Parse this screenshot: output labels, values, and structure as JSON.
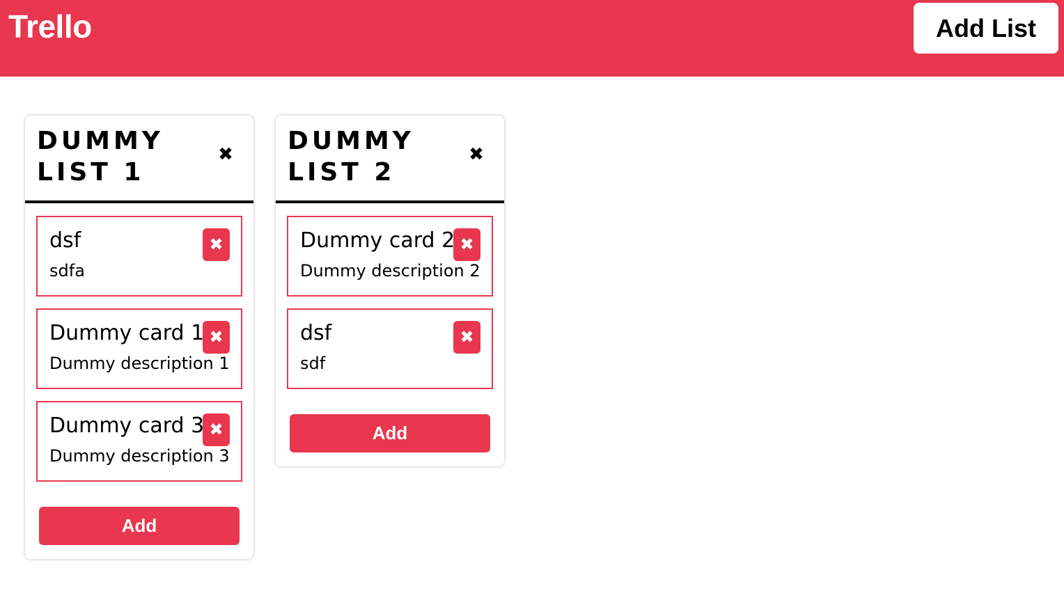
{
  "header": {
    "brand": "Trello",
    "add_list_label": "Add List"
  },
  "icons": {
    "close": "heavy-multiplication-x-icon"
  },
  "colors": {
    "accent": "#e8374f",
    "background": "#ffffff",
    "text": "#000000"
  },
  "lists": [
    {
      "title": "Dummy List 1",
      "close_glyph": "✖",
      "add_label": "Add",
      "cards": [
        {
          "title": "dsf",
          "description": "sdfa",
          "delete_glyph": "✖"
        },
        {
          "title": "Dummy card 1",
          "description": "Dummy description 1",
          "delete_glyph": "✖"
        },
        {
          "title": "Dummy card 3",
          "description": "Dummy description 3",
          "delete_glyph": "✖"
        }
      ]
    },
    {
      "title": "Dummy List 2",
      "close_glyph": "✖",
      "add_label": "Add",
      "cards": [
        {
          "title": "Dummy card 2",
          "description": "Dummy description 2",
          "delete_glyph": "✖"
        },
        {
          "title": "dsf",
          "description": "sdf",
          "delete_glyph": "✖"
        }
      ]
    }
  ]
}
